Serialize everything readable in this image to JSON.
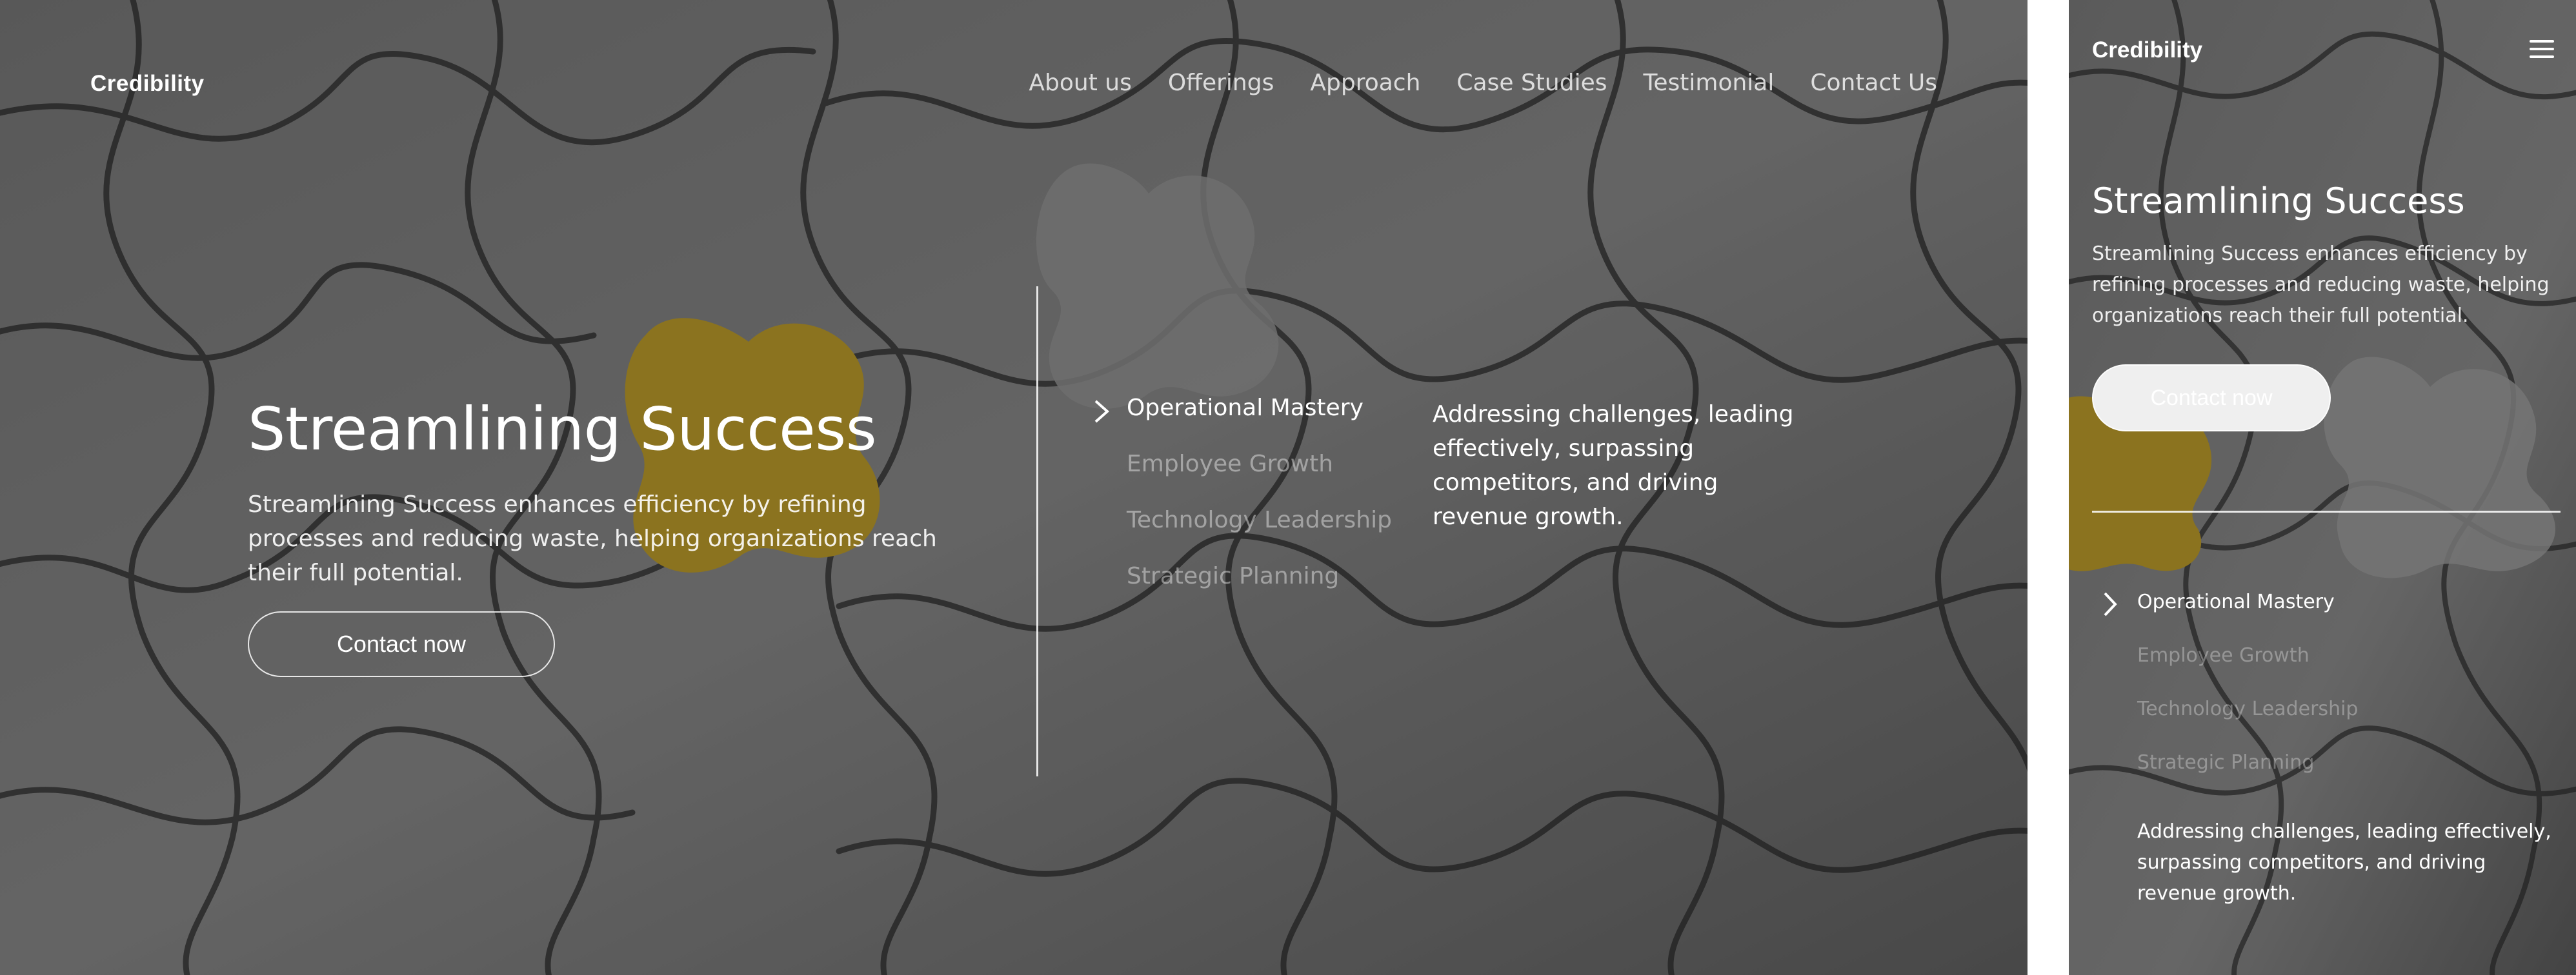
{
  "brand": "Credibility",
  "nav": [
    "About us",
    "Offerings",
    "Approach",
    "Case Studies",
    "Testimonial",
    "Contact Us"
  ],
  "hero": {
    "title": "Streamlining Success",
    "description": "Streamlining Success enhances efficiency by refining processes and reducing waste, helping organizations reach their full potential.",
    "cta_label": "Contact now"
  },
  "services": {
    "items": [
      "Operational Mastery",
      "Employee Growth",
      "Technology Leadership",
      "Strategic Planning"
    ],
    "active_index": 0,
    "active_description": "Addressing challenges, leading effectively, surpassing competitors, and driving revenue growth."
  },
  "icons": {
    "active_marker": "chevron-right-icon",
    "mobile_menu": "hamburger-menu-icon"
  },
  "colors": {
    "accent_piece": "#c9a21a",
    "overlay": "#3a3a3a",
    "text": "#ffffff"
  }
}
